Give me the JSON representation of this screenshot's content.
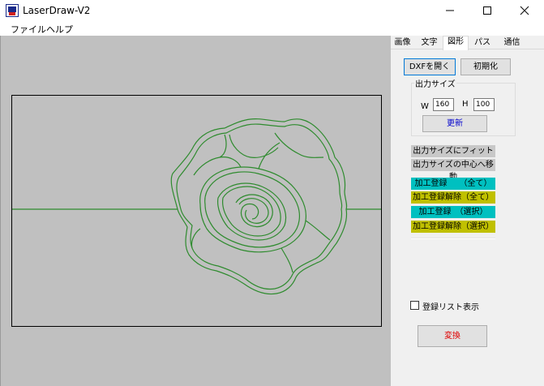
{
  "window": {
    "title": "LaserDraw-V2",
    "app_icon": "laserdraw-app-icon",
    "controls": [
      "minimize-icon",
      "maximize-icon",
      "close-icon"
    ]
  },
  "menu": {
    "items": [
      {
        "label": "ファイル"
      },
      {
        "label": "ヘルプ"
      }
    ]
  },
  "tabs": [
    {
      "label": "画像",
      "active": false
    },
    {
      "label": "文字",
      "active": false
    },
    {
      "label": "図形",
      "active": true
    },
    {
      "label": "パス",
      "active": false
    },
    {
      "label": "通信",
      "active": false
    }
  ],
  "shape_panel": {
    "open_dxf_label": "DXFを開く",
    "reset_label": "初期化",
    "output_size": {
      "title": "出力サイズ",
      "w_label": "W",
      "w_value": "160",
      "h_label": "H",
      "h_value": "100",
      "update_label": "更新"
    },
    "fit_output_label": "出力サイズにフィット",
    "move_center_label": "出力サイズの中心へ移動",
    "register_all_label": "加工登録　　（全て）",
    "unregister_all_label": "加工登録解除（全て）",
    "register_selected_label": "加工登録　（選択）",
    "unregister_selected_label": "加工登録解除（選択）",
    "show_list_label": "登録リスト表示",
    "show_list_checked": false,
    "convert_label": "変換"
  },
  "colors": {
    "canvas_bg": "#c0c0c0",
    "drawing_stroke": "#2e8b2e",
    "register_bg": "#00c0c0",
    "unregister_bg": "#c0c000",
    "convert_text": "#e00000",
    "update_text": "#0000cc"
  }
}
